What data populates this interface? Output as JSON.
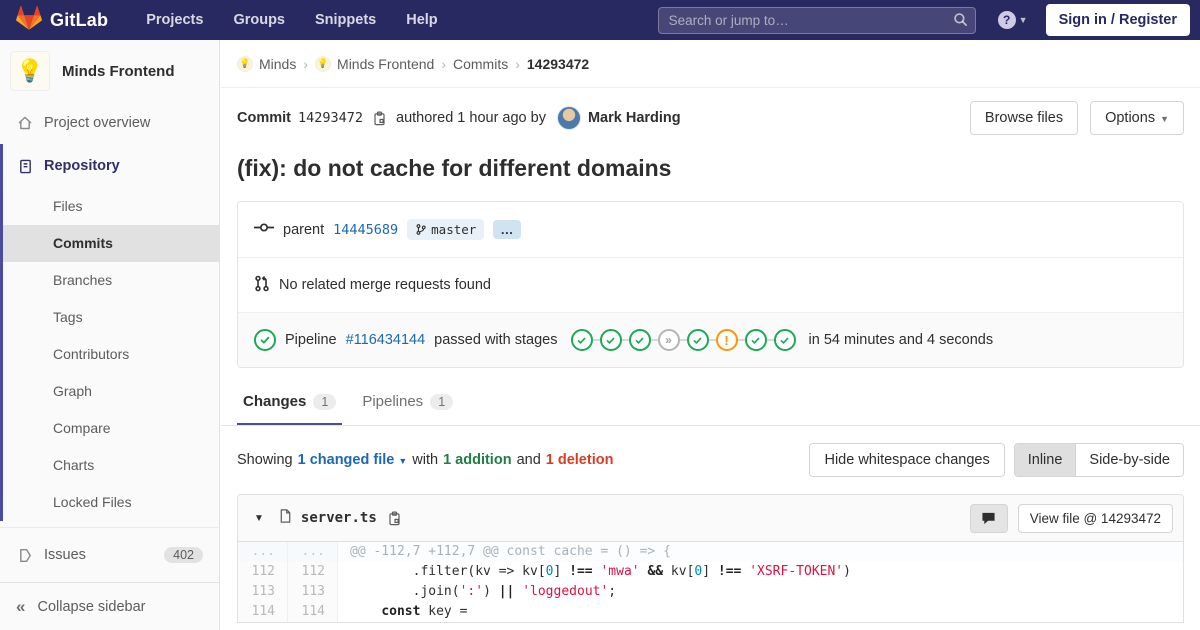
{
  "navbar": {
    "brand": "GitLab",
    "menu": [
      "Projects",
      "Groups",
      "Snippets",
      "Help"
    ],
    "search_placeholder": "Search or jump to…",
    "sign_in": "Sign in / Register"
  },
  "sidebar": {
    "project_name": "Minds Frontend",
    "project_avatar": "💡",
    "overview_label": "Project overview",
    "repository_label": "Repository",
    "repo_items": [
      "Files",
      "Commits",
      "Branches",
      "Tags",
      "Contributors",
      "Graph",
      "Compare",
      "Charts",
      "Locked Files"
    ],
    "active_item": "Commits",
    "issues_label": "Issues",
    "issues_count": "402",
    "collapse_label": "Collapse sidebar"
  },
  "breadcrumb": {
    "items": [
      {
        "label": "Minds",
        "avatar": "💡"
      },
      {
        "label": "Minds Frontend",
        "avatar": "💡"
      },
      {
        "label": "Commits"
      },
      {
        "label": "14293472",
        "current": true
      }
    ]
  },
  "commit": {
    "label": "Commit",
    "sha": "14293472",
    "authored_text": "authored 1 hour ago by",
    "author": "Mark Harding",
    "browse_files": "Browse files",
    "options": "Options",
    "title": "(fix): do not cache for different domains",
    "parent_label": "parent",
    "parent_sha": "14445689",
    "branch": "master",
    "mr_text": "No related merge requests found",
    "pipeline_label": "Pipeline",
    "pipeline_id": "#116434144",
    "pipeline_status": "passed with stages",
    "pipeline_duration": "in 54 minutes and 4 seconds",
    "stages": [
      "success",
      "success",
      "success",
      "skipped",
      "success",
      "warning",
      "success",
      "success"
    ]
  },
  "tabs": [
    {
      "label": "Changes",
      "count": "1",
      "active": true
    },
    {
      "label": "Pipelines",
      "count": "1",
      "active": false
    }
  ],
  "summary": {
    "showing": "Showing",
    "changed_files": "1 changed file",
    "with_word": "with",
    "additions": "1 addition",
    "and_word": "and",
    "deletions": "1 deletion",
    "hide_whitespace": "Hide whitespace changes",
    "inline": "Inline",
    "side_by_side": "Side-by-side"
  },
  "diff": {
    "file_name": "server.ts",
    "view_file": "View file @ 14293472",
    "lines": [
      {
        "old": "...",
        "new": "...",
        "type": "match",
        "tokens": [
          {
            "c": "m",
            "t": "@@ -112,7 +112,7 @@ const cache = () => {"
          }
        ]
      },
      {
        "old": "112",
        "new": "112",
        "type": "ctx",
        "tokens": [
          {
            "c": "p",
            "t": "        .filter(kv => kv["
          },
          {
            "c": "n",
            "t": "0"
          },
          {
            "c": "p",
            "t": "] "
          },
          {
            "c": "o",
            "t": "!=="
          },
          {
            "c": "p",
            "t": " "
          },
          {
            "c": "s",
            "t": "'mwa'"
          },
          {
            "c": "p",
            "t": " "
          },
          {
            "c": "o",
            "t": "&&"
          },
          {
            "c": "p",
            "t": " kv["
          },
          {
            "c": "n",
            "t": "0"
          },
          {
            "c": "p",
            "t": "] "
          },
          {
            "c": "o",
            "t": "!=="
          },
          {
            "c": "p",
            "t": " "
          },
          {
            "c": "s",
            "t": "'XSRF-TOKEN'"
          },
          {
            "c": "p",
            "t": ")"
          }
        ]
      },
      {
        "old": "113",
        "new": "113",
        "type": "ctx",
        "tokens": [
          {
            "c": "p",
            "t": "        .join("
          },
          {
            "c": "s",
            "t": "':'"
          },
          {
            "c": "p",
            "t": ") "
          },
          {
            "c": "o",
            "t": "||"
          },
          {
            "c": "p",
            "t": " "
          },
          {
            "c": "s",
            "t": "'loggedout'"
          },
          {
            "c": "p",
            "t": ";"
          }
        ]
      },
      {
        "old": "114",
        "new": "114",
        "type": "ctx",
        "tokens": [
          {
            "c": "p",
            "t": "    "
          },
          {
            "c": "k",
            "t": "const"
          },
          {
            "c": "p",
            "t": " key ="
          }
        ]
      }
    ]
  },
  "colors": {
    "navbar_bg": "#292961",
    "accent": "#4b4ba3",
    "link": "#1b69b6",
    "success": "#1aaa55",
    "warning": "#fc9403",
    "addition": "#1e7e45",
    "deletion": "#db3b21"
  }
}
